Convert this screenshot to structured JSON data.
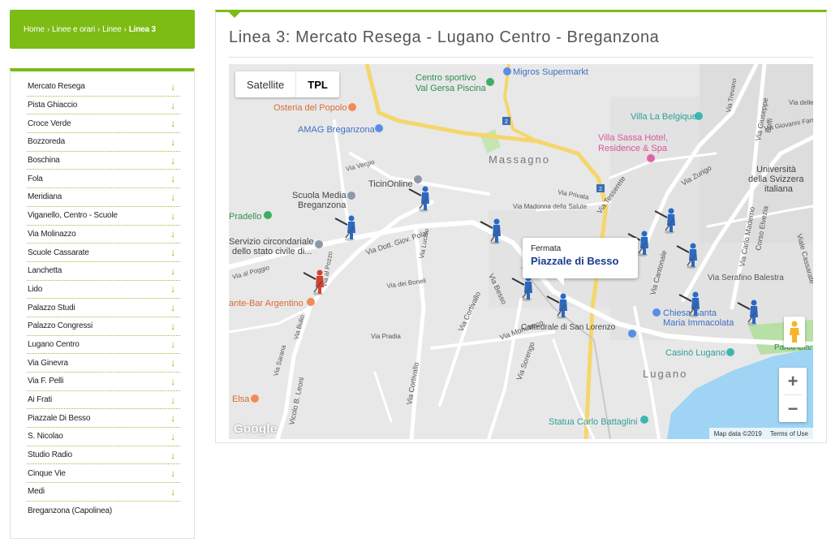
{
  "breadcrumb": {
    "home": "Home",
    "lines_schedules": "Linee e orari",
    "lines": "Linee",
    "current": "Linea 3",
    "separator": "›"
  },
  "stops": [
    {
      "name": "Mercato Resega",
      "arrow": true
    },
    {
      "name": "Pista Ghiaccio",
      "arrow": true
    },
    {
      "name": "Croce Verde",
      "arrow": true
    },
    {
      "name": "Bozzoreda",
      "arrow": true
    },
    {
      "name": "Boschina",
      "arrow": true
    },
    {
      "name": "Fola",
      "arrow": true
    },
    {
      "name": "Meridiana",
      "arrow": true
    },
    {
      "name": "Viganello, Centro - Scuole",
      "arrow": true
    },
    {
      "name": "Via Molinazzo",
      "arrow": true
    },
    {
      "name": "Scuole Cassarate",
      "arrow": true
    },
    {
      "name": "Lanchetta",
      "arrow": true
    },
    {
      "name": "Lido",
      "arrow": true
    },
    {
      "name": "Palazzo Studi",
      "arrow": true
    },
    {
      "name": "Palazzo Congressi",
      "arrow": true
    },
    {
      "name": "Lugano Centro",
      "arrow": true
    },
    {
      "name": "Via Ginevra",
      "arrow": true
    },
    {
      "name": "Via F. Pelli",
      "arrow": true
    },
    {
      "name": "Ai Frati",
      "arrow": true
    },
    {
      "name": "Piazzale Di Besso",
      "arrow": true
    },
    {
      "name": "S. Nicolao",
      "arrow": true
    },
    {
      "name": "Studio Radio",
      "arrow": true
    },
    {
      "name": "Cinque Vie",
      "arrow": true
    },
    {
      "name": "Medi",
      "arrow": true
    },
    {
      "name": "Breganzona (Capolinea)",
      "arrow": false
    }
  ],
  "arrow_glyph": "↓",
  "title": "Linea 3: Mercato Resega - Lugano Centro - Breganzona",
  "map": {
    "map_type": {
      "satellite": "Satellite",
      "tpl": "TPL",
      "active": "TPL"
    },
    "info_window": {
      "label": "Fermata",
      "stop": "Piazzale di Besso"
    },
    "zoom_in": "+",
    "zoom_out": "−",
    "footer": {
      "map_data": "Map data ©2019",
      "terms": "Terms of Use"
    },
    "google_logo": "Google",
    "labels": {
      "migros": "Migros Supermarkt",
      "centro_sportivo_1": "Centro sportivo",
      "centro_sportivo_2": "Val Gersa Piscina",
      "osteria": "Osteria del Popolo",
      "amag": "AMAG Breganzona",
      "villa_belgique": "Villa La Belgique",
      "villa_sassa_1": "Villa Sassa Hotel,",
      "villa_sassa_2": "Residence & Spa",
      "massagno": "Massagno",
      "universita_1": "Università",
      "universita_2": "della Svizzera",
      "universita_3": "italiana",
      "ticinonline": "TicinOnline",
      "scuola_media_1": "Scuola Media",
      "scuola_media_2": "Breganzona",
      "pradello": "Pradello",
      "servizio_1": "Servizio circondariale",
      "servizio_2": "dello stato civile di...",
      "ristorante": "ante-Bar Argentino",
      "chiesa_1": "Chiesa Santa",
      "chiesa_2": "Maria Immacolata",
      "cattedrale": "Cattedrale di San Lorenzo",
      "casino": "Casinò Lugano",
      "lugano": "Lugano",
      "parco_ciani": "Parco Ciani",
      "elsa": "Elsa",
      "statua": "Statua Carlo Battaglini",
      "via_serafino": "Via Serafino Balestra",
      "via_besso": "Via Besso",
      "via_moncucco": "Via Moncucco",
      "via_cortivallo": "Via Cortivallo",
      "via_sorengo": "Via Sorengo",
      "via_dott": "Via Dott. Giov. Polar",
      "via_zurigo": "Via Zurigo",
      "via_tesserete": "Via Tesserete",
      "via_giuseppe_1": "Via Giuseppe",
      "via_giuseppe_2": "Buffi",
      "via_carlo_maderno": "Via Carlo Maderno",
      "corso_elvezia": "Corso Elvezia",
      "via_cantonale": "Via Cantonale",
      "via_madonna": "Via Madonna della Salute",
      "via_pradia": "Via Pradia",
      "via_privata": "Via Privata",
      "via_vergio": "Via Vergio",
      "via_dei_boneti": "Via dei Boneli",
      "via_cassarate": "Viale Cassarate",
      "via_trevano": "Via Trevano",
      "via_delle": "Via delle",
      "via_giovanni": "Via Giovanni Farri",
      "via_al_poggio": "Via al Poggio",
      "via_al_pozzo": "Via al Pozzo",
      "via_bulio": "Via Bulio",
      "via_sarana": "Via Sarana",
      "via_leoni": "Vicolo B. Leoni",
      "via_lucino": "Via Lucino",
      "route_2": "2"
    }
  },
  "colors": {
    "accent_green": "#7cbc14",
    "stop_blue": "#2a69c4",
    "stop_red": "#d9402f",
    "water": "#9fd4f4",
    "park": "#b8e0a6"
  }
}
